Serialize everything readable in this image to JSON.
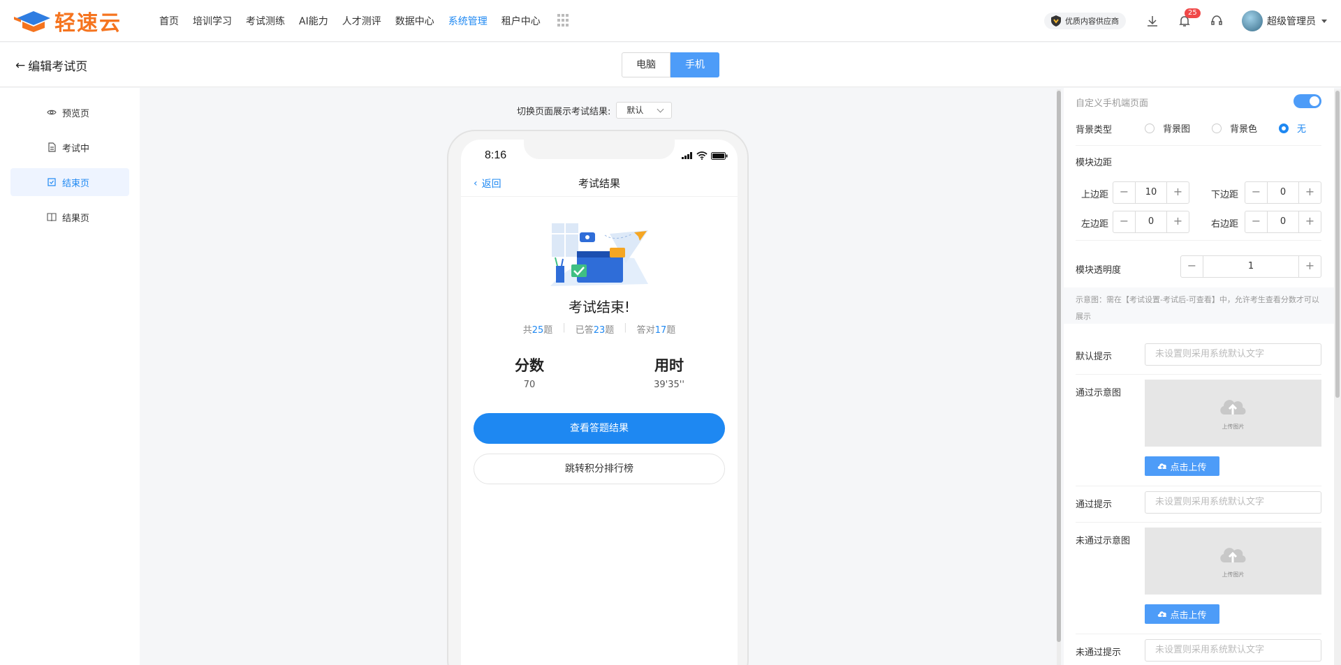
{
  "brand": {
    "name": "轻速云",
    "color": "#f5741f"
  },
  "nav": {
    "items": [
      {
        "label": "首页",
        "active": false
      },
      {
        "label": "培训学习",
        "active": false
      },
      {
        "label": "考试测练",
        "active": false
      },
      {
        "label": "AI能力",
        "active": false
      },
      {
        "label": "人才测评",
        "active": false
      },
      {
        "label": "数据中心",
        "active": false
      },
      {
        "label": "系统管理",
        "active": true
      },
      {
        "label": "租户中心",
        "active": false
      }
    ],
    "more_icon": "apps-grid-icon"
  },
  "topbar_right": {
    "provider_label": "优质内容供应商",
    "notification_count": "25",
    "user_name": "超级管理员"
  },
  "page": {
    "title": "编辑考试页",
    "device_tabs": [
      {
        "label": "电脑",
        "active": false
      },
      {
        "label": "手机",
        "active": true
      }
    ]
  },
  "sidebar": {
    "items": [
      {
        "label": "预览页",
        "icon": "eye-icon",
        "active": false
      },
      {
        "label": "考试中",
        "icon": "document-icon",
        "active": false
      },
      {
        "label": "结束页",
        "icon": "checkbox-icon",
        "active": true
      },
      {
        "label": "结果页",
        "icon": "book-icon",
        "active": false
      }
    ]
  },
  "canvas": {
    "switch_label": "切换页面展示考试结果:",
    "switch_value": "默认"
  },
  "phone": {
    "time": "8:16",
    "back_label": "返回",
    "title": "考试结果",
    "done_title": "考试结束!",
    "stats": {
      "total_prefix": "共",
      "total": "25",
      "total_suffix": "题",
      "answered_prefix": "已答",
      "answered": "23",
      "answered_suffix": "题",
      "correct_prefix": "答对",
      "correct": "17",
      "correct_suffix": "题"
    },
    "score_label": "分数",
    "score_value": "70",
    "time_label": "用时",
    "time_value": "39'35''",
    "primary_button": "查看答题结果",
    "secondary_button": "跳转积分排行榜"
  },
  "panel": {
    "custom_mobile_label": "自定义手机端页面",
    "custom_mobile_enabled": true,
    "bg_type_label": "背景类型",
    "bg_options": [
      {
        "label": "背景图",
        "checked": false
      },
      {
        "label": "背景色",
        "checked": false
      },
      {
        "label": "无",
        "checked": true
      }
    ],
    "margin_label": "模块边距",
    "margins": {
      "top_label": "上边距",
      "top": "10",
      "bottom_label": "下边距",
      "bottom": "0",
      "left_label": "左边距",
      "left": "0",
      "right_label": "右边距",
      "right": "0"
    },
    "opacity_label": "模块透明度",
    "opacity": "1",
    "hint": "示意图：需在【考试设置-考试后-可查看】中，允许考生查看分数才可以展示",
    "default_tip_label": "默认提示",
    "input_placeholder": "未设置则采用系统默认文字",
    "pass_image_label": "通过示意图",
    "upload_image_label": "上传图片",
    "upload_button": "点击上传",
    "pass_tip_label": "通过提示",
    "fail_image_label": "未通过示意图",
    "fail_tip_label": "未通过提示"
  },
  "colors": {
    "accent": "#1e88f2",
    "accent_light": "#4d9cf8",
    "badge": "#f04848"
  }
}
